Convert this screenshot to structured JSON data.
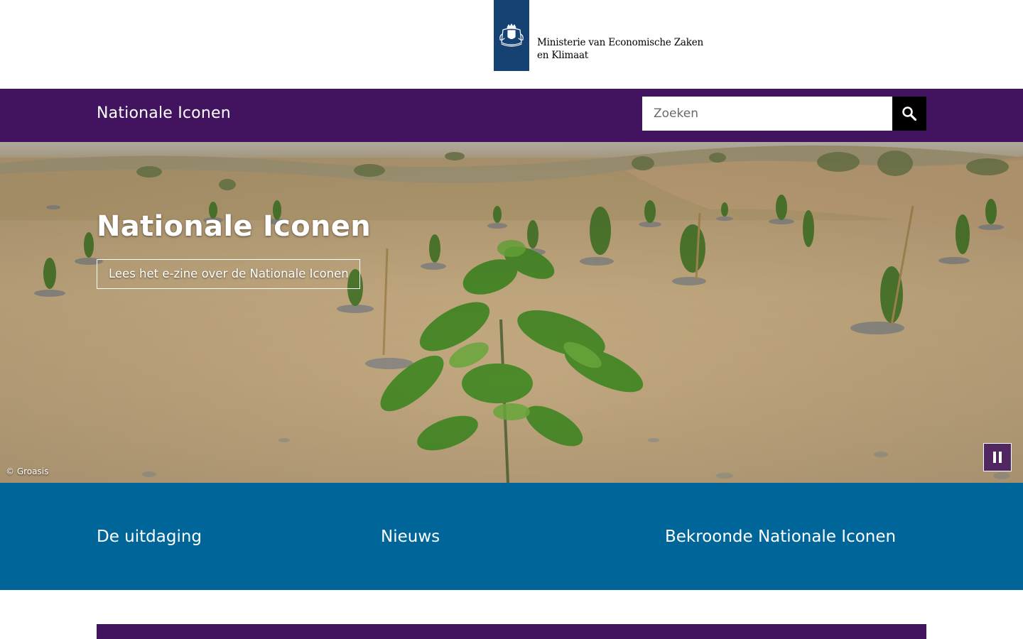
{
  "header": {
    "ministry_line1": "Ministerie van Economische Zaken",
    "ministry_line2": "en Klimaat",
    "logo_icon": "coat-of-arms-icon",
    "brand_color": "#154273"
  },
  "navbar": {
    "site_title": "Nationale Iconen",
    "search_placeholder": "Zoeken",
    "search_icon": "search-icon",
    "bar_color": "#42145f"
  },
  "hero": {
    "title": "Nationale Iconen",
    "link_label": "Lees het e-zine over de Nationale Iconen",
    "photo_credit": "© Groasis",
    "pause_icon": "pause-icon"
  },
  "section_nav": {
    "color": "#006699",
    "items": [
      {
        "label": "De uitdaging"
      },
      {
        "label": "Nieuws"
      },
      {
        "label": "Bekroonde Nationale Iconen"
      }
    ]
  }
}
